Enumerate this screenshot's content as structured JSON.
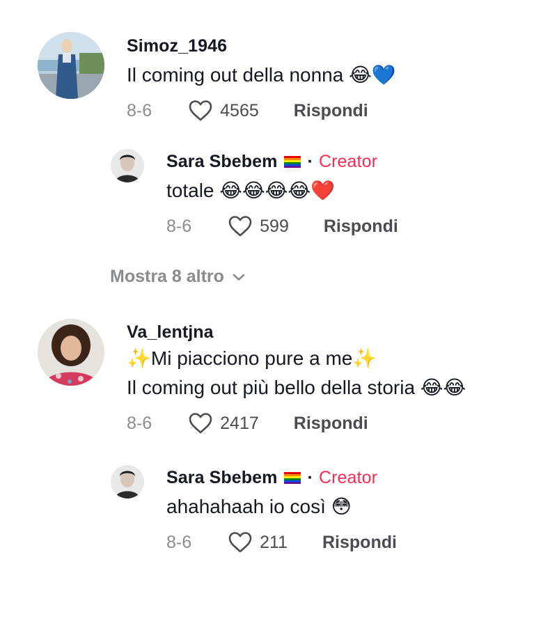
{
  "comments": [
    {
      "username": "Simoz_1946",
      "text_lines": [
        "Il coming out della nonna 😂💙"
      ],
      "date": "8-6",
      "likes": "4565",
      "reply_label": "Rispondi",
      "replies": [
        {
          "username": "Sara Sbebem",
          "separator": "·",
          "creator_label": "Creator",
          "text_lines": [
            "totale 😂😂😂😂❤️"
          ],
          "date": "8-6",
          "likes": "599",
          "reply_label": "Rispondi"
        }
      ],
      "more_label": "Mostra 8 altro"
    },
    {
      "username": "Va_lentjna",
      "text_lines": [
        "✨Mi piacciono pure a me✨",
        "Il coming out più bello della storia 😂😂"
      ],
      "date": "8-6",
      "likes": "2417",
      "reply_label": "Rispondi",
      "replies": [
        {
          "username": "Sara Sbebem",
          "separator": "·",
          "creator_label": "Creator",
          "text_lines": [
            "ahahahaah io così 😳"
          ],
          "date": "8-6",
          "likes": "211",
          "reply_label": "Rispondi"
        }
      ]
    }
  ],
  "icons": {
    "like": "heart-outline-icon",
    "expand": "chevron-down-icon",
    "flag": "rainbow-flag-icon"
  },
  "colors": {
    "creator": "#fe2c55",
    "muted": "#8a8b91",
    "text": "#161823"
  }
}
